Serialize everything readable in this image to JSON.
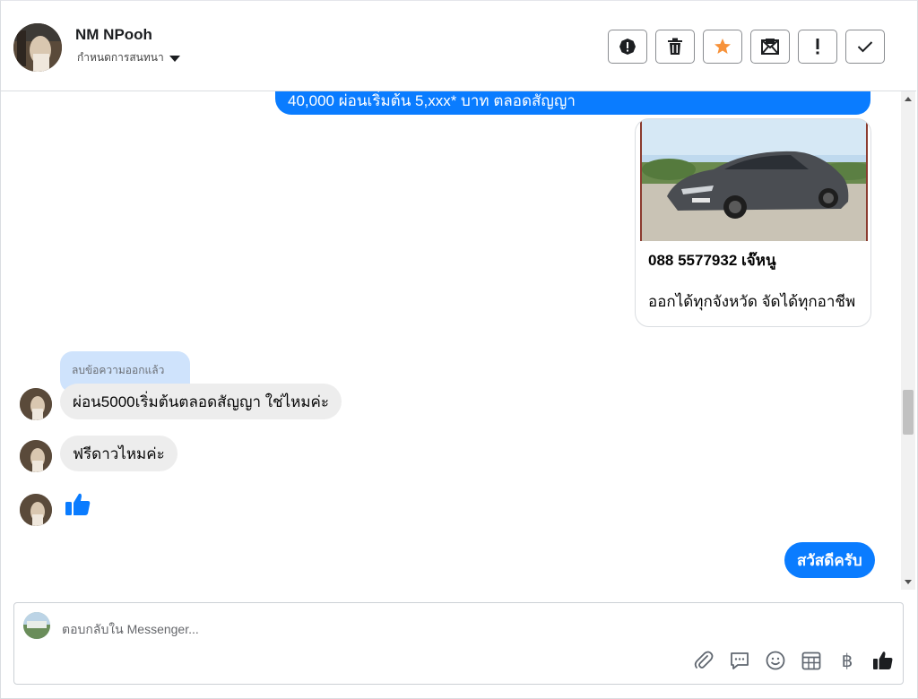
{
  "header": {
    "contact_name": "NM NPooh",
    "conversation_settings": "กำหนดการสนทนา",
    "actions": [
      {
        "icon": "alert-circle-icon",
        "name": "spam-button"
      },
      {
        "icon": "trash-icon",
        "name": "delete-button"
      },
      {
        "icon": "star-icon",
        "name": "star-button",
        "color": "#f7923a"
      },
      {
        "icon": "mark-unread-icon",
        "name": "mark-unread-button"
      },
      {
        "icon": "exclamation-icon",
        "name": "follow-up-button"
      },
      {
        "icon": "checkmark-icon",
        "name": "done-button"
      }
    ]
  },
  "chat": {
    "outgoing_top_text": "40,000 ผ่อนเริ่มต้น 5,xxx* บาท ตลอดสัญญา",
    "card": {
      "title": "088 5577932 เจ๊หนู",
      "subtitle": "ออกได้ทุกจังหวัด จัดได้ทุกอาชีพ"
    },
    "reply_tag": "ลบข้อความออกแล้ว",
    "incoming": [
      {
        "text": "ผ่อน5000เริ่มต้นตลอดสัญญา ใช่ไหมค่ะ"
      },
      {
        "text": "ฟรีดาวไหมค่ะ"
      }
    ],
    "incoming_like_icon": "thumbs-up-icon",
    "outgoing_bottom_text": "สวัสดีครับ",
    "accent_color": "#0a7cff"
  },
  "composer": {
    "placeholder": "ตอบกลับใน Messenger...",
    "tools": [
      {
        "icon": "paperclip-icon",
        "name": "attach-button"
      },
      {
        "icon": "saved-reply-icon",
        "name": "saved-replies-button"
      },
      {
        "icon": "emoji-icon",
        "name": "emoji-button"
      },
      {
        "icon": "appointment-icon",
        "name": "appointment-button"
      },
      {
        "icon": "baht-icon",
        "name": "payment-button",
        "glyph": "฿"
      },
      {
        "icon": "thumbs-up-icon",
        "name": "send-like-button"
      }
    ]
  }
}
